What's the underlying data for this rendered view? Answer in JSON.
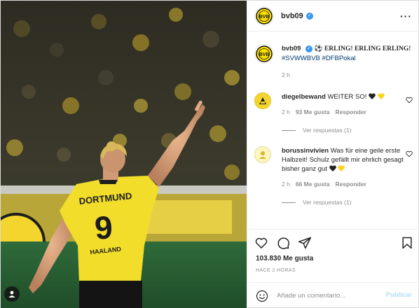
{
  "post_header": {
    "username": "bvb09",
    "verified": true,
    "more_icon": "more-horizontal-icon"
  },
  "caption": {
    "username": "bvb09",
    "text_bold": "⚽ ERLING! ERLING ERLING!",
    "hashtags": "#SVWWBVB #DFBPokal",
    "time": "2 h"
  },
  "comments": [
    {
      "username": "diegelbewand",
      "text": "WEITER SO!",
      "emoji": [
        "black-heart",
        "yellow-heart"
      ],
      "time": "2 h",
      "likes": "93 Me gusta",
      "reply_label": "Responder",
      "view_replies": "Ver respuestas (1)"
    },
    {
      "username": "borussinvivien",
      "text": "Was für eine geile erste Halbzeit! Schulz gefällt mir ehrlich gesagt bisher ganz gut",
      "emoji": [
        "black-heart",
        "yellow-heart"
      ],
      "time": "2 h",
      "likes": "66 Me gusta",
      "reply_label": "Responder",
      "view_replies": "Ver respuestas (1)"
    }
  ],
  "actions": {
    "like_icon": "heart-icon",
    "comment_icon": "comment-icon",
    "share_icon": "paper-plane-icon",
    "save_icon": "bookmark-icon",
    "likes_count": "103.830",
    "likes_label": "Me gusta",
    "date": "HACE 2 HORAS"
  },
  "add_comment": {
    "emoji_icon": "smiley-icon",
    "placeholder": "Añade un comentario...",
    "publish_label": "Publicar"
  },
  "photo": {
    "jersey_number": "9",
    "jersey_name": "DORTMUND",
    "jersey_name_bottom": "HAALAND",
    "tag_icon": "user-tag-icon"
  },
  "colors": {
    "bvb_yellow": "#fde100",
    "link_blue": "#00376b",
    "verified_blue": "#3897f0",
    "muted_text": "#8e8e8e",
    "publish_disabled": "#b2dffc"
  }
}
